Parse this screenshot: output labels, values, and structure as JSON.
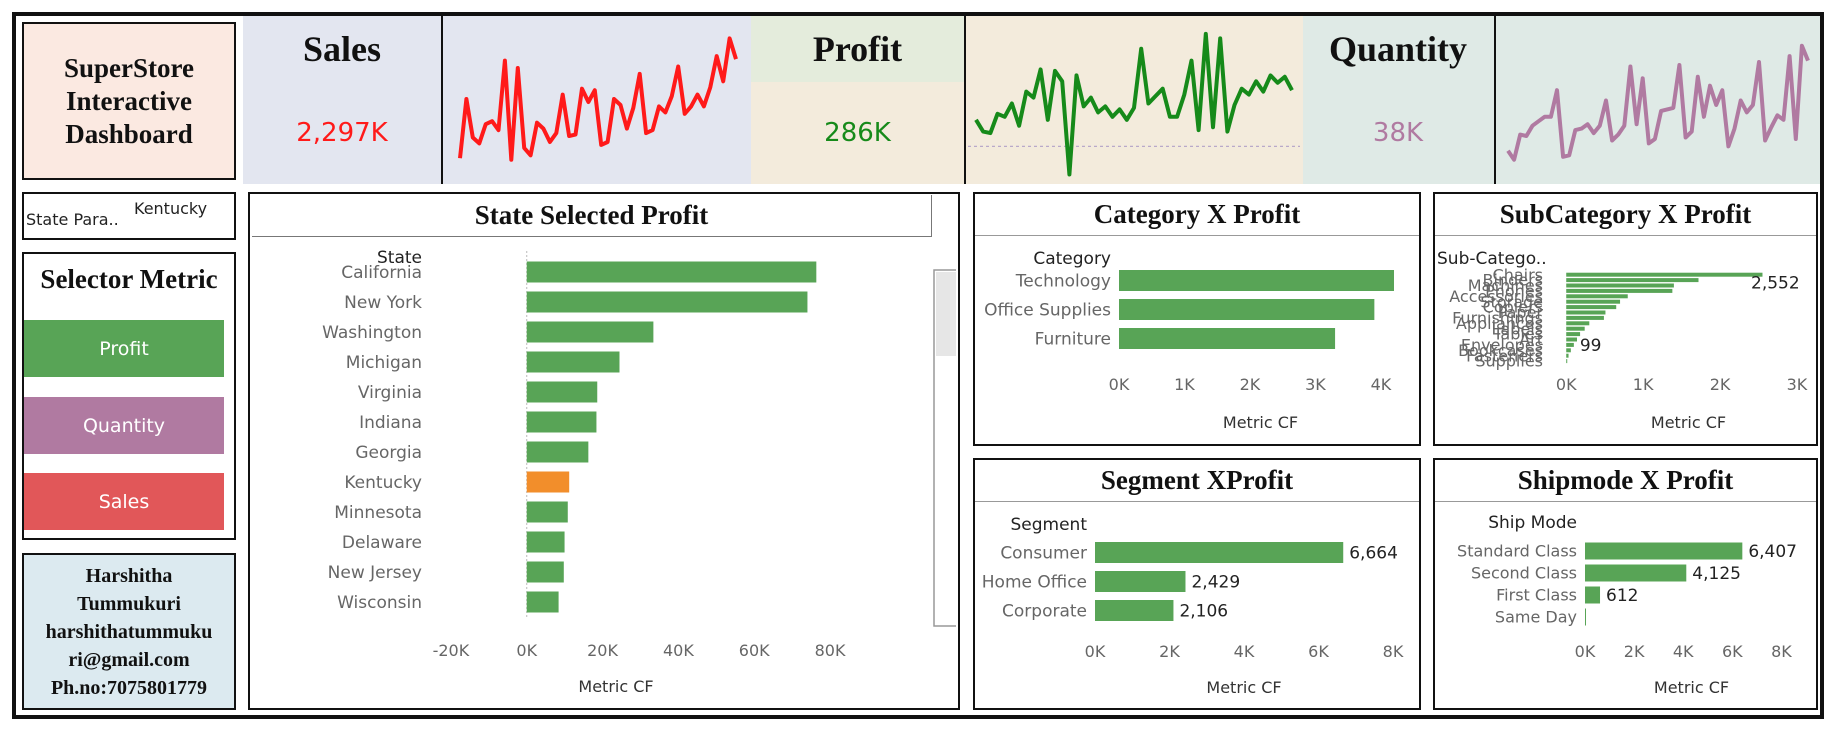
{
  "title_card": {
    "lines": [
      "SuperStore",
      "Interactive",
      "Dashboard"
    ]
  },
  "kpis": [
    {
      "label": "Sales",
      "value": "2,297K",
      "color": "#ff1a1a",
      "bg": "#e3e6f0"
    },
    {
      "label": "Profit",
      "value": "286K",
      "color": "#168a1a",
      "bg": "#f3ebdc"
    },
    {
      "label": "Quantity",
      "value": "38K",
      "color": "#b07aa1",
      "bg": "#dfeae6"
    }
  ],
  "sparklines": {
    "sales": [
      12,
      52,
      26,
      22,
      35,
      37,
      31,
      78,
      11,
      73,
      19,
      14,
      36,
      32,
      23,
      29,
      55,
      27,
      28,
      59,
      50,
      58,
      21,
      23,
      52,
      48,
      32,
      46,
      69,
      29,
      31,
      47,
      43,
      54,
      74,
      42,
      47,
      55,
      47,
      60,
      81,
      64,
      93,
      79
    ],
    "profit": [
      38,
      30,
      29,
      42,
      40,
      49,
      34,
      57,
      53,
      72,
      38,
      71,
      64,
      1,
      68,
      47,
      53,
      43,
      47,
      40,
      45,
      38,
      46,
      86,
      49,
      54,
      59,
      40,
      40,
      55,
      78,
      31,
      96,
      33,
      93,
      30,
      48,
      59,
      55,
      64,
      57,
      68,
      63,
      67,
      58
    ],
    "quantity": [
      17,
      11,
      28,
      27,
      34,
      37,
      40,
      40,
      58,
      13,
      14,
      31,
      32,
      35,
      29,
      34,
      51,
      24,
      28,
      34,
      74,
      35,
      66,
      22,
      25,
      44,
      45,
      46,
      75,
      26,
      30,
      67,
      40,
      61,
      48,
      58,
      20,
      32,
      51,
      43,
      48,
      77,
      24,
      33,
      41,
      38,
      81,
      25,
      88,
      78
    ]
  },
  "state_param": {
    "label": "State Para..",
    "value": "Kentucky"
  },
  "selector": {
    "title": "Selector Metric",
    "buttons": [
      {
        "label": "Profit",
        "color": "#58a456"
      },
      {
        "label": "Quantity",
        "color": "#b07aa1"
      },
      {
        "label": "Sales",
        "color": "#e15759"
      }
    ]
  },
  "author": {
    "lines": [
      "Harshitha",
      "Tummukuri",
      "harshithatummuku",
      "ri@gmail.com",
      "Ph.no:7075801779"
    ]
  },
  "chart_data": [
    {
      "type": "bar",
      "title": "State Selected Profit",
      "dimension_label": "State",
      "xlabel": "Metric CF",
      "categories": [
        "California",
        "New York",
        "Washington",
        "Michigan",
        "Virginia",
        "Indiana",
        "Georgia",
        "Kentucky",
        "Minnesota",
        "Delaware",
        "New Jersey",
        "Wisconsin"
      ],
      "values": [
        76381,
        74039,
        33403,
        24463,
        18598,
        18383,
        16250,
        11200,
        10823,
        9977,
        9773,
        8402
      ],
      "highlight": "Kentucky",
      "highlight_color": "#f28e2b",
      "bar_color": "#58a456",
      "xlim": [
        -30000,
        85000
      ],
      "ticks": [
        -20000,
        0,
        20000,
        40000,
        60000,
        80000
      ],
      "tick_labels": [
        "-20K",
        "0K",
        "20K",
        "40K",
        "60K",
        "80K"
      ]
    },
    {
      "type": "bar",
      "title": "Category X Profit",
      "dimension_label": "Category",
      "xlabel": "Metric CF",
      "categories": [
        "Technology",
        "Office Supplies",
        "Furniture"
      ],
      "values": [
        4200,
        3900,
        3300
      ],
      "bar_color": "#58a456",
      "xlim": [
        0,
        4200
      ],
      "ticks": [
        0,
        1000,
        2000,
        3000,
        4000
      ],
      "tick_labels": [
        "0K",
        "1K",
        "2K",
        "3K",
        "4K"
      ]
    },
    {
      "type": "bar",
      "title": "SubCategory X Profit",
      "dimension_label": "Sub-Catego..",
      "xlabel": "Metric CF",
      "categories": [
        "Chairs",
        "Binders",
        "Machines",
        "Phones",
        "Accessories",
        "Storage",
        "Copiers",
        "Paper",
        "Furnishings",
        "Appliances",
        "Labels",
        "Tables",
        "Art",
        "Envelopes",
        "Bookcases",
        "Fasteners",
        "Supplies"
      ],
      "values": [
        2552,
        1720,
        1400,
        1380,
        800,
        700,
        650,
        510,
        490,
        300,
        240,
        180,
        140,
        99,
        60,
        30,
        10
      ],
      "value_labels": {
        "0": "2,552",
        "13": "99"
      },
      "bar_color": "#58a456",
      "xlim": [
        -120,
        3300
      ],
      "ticks": [
        0,
        1000,
        2000,
        3000
      ],
      "tick_labels": [
        "0K",
        "1K",
        "2K",
        "3K"
      ]
    },
    {
      "type": "bar",
      "title": "Segment XProfit",
      "dimension_label": "Segment",
      "xlabel": "Metric CF",
      "categories": [
        "Consumer",
        "Home Office",
        "Corporate"
      ],
      "values": [
        6664,
        2429,
        2106
      ],
      "value_labels": [
        "6,664",
        "2,429",
        "2,106"
      ],
      "bar_color": "#58a456",
      "xlim": [
        0,
        8000
      ],
      "ticks": [
        0,
        2000,
        4000,
        6000,
        8000
      ],
      "tick_labels": [
        "0K",
        "2K",
        "4K",
        "6K",
        "8K"
      ]
    },
    {
      "type": "bar",
      "title": "Shipmode X Profit",
      "dimension_label": "Ship Mode",
      "xlabel": "Metric CF",
      "categories": [
        "Standard Class",
        "Second Class",
        "First Class",
        "Same Day"
      ],
      "values": [
        6407,
        4125,
        612,
        40
      ],
      "value_labels": [
        "6,407",
        "4,125",
        "612",
        ""
      ],
      "bar_color": "#58a456",
      "xlim": [
        0,
        9000
      ],
      "ticks": [
        0,
        2000,
        4000,
        6000,
        8000
      ],
      "tick_labels": [
        "0K",
        "2K",
        "4K",
        "6K",
        "8K"
      ]
    }
  ]
}
